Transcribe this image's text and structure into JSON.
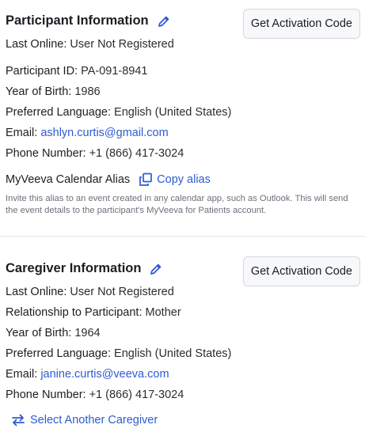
{
  "participant": {
    "title": "Participant Information",
    "activation_button": "Get Activation Code",
    "last_online_label": "Last Online:",
    "last_online_value": "User Not Registered",
    "id_label": "Participant ID:",
    "id_value": "PA-091-8941",
    "yob_label": "Year of Birth:",
    "yob_value": "1986",
    "language_label": "Preferred Language:",
    "language_value": "English (United States)",
    "email_label": "Email:",
    "email_value": "ashlyn.curtis@gmail.com",
    "phone_label": "Phone Number:",
    "phone_value": "+1 (866) 417-3024",
    "alias_label": "MyVeeva Calendar Alias",
    "copy_alias": "Copy alias",
    "alias_note": "Invite this alias to an event created in any calendar app, such as Outlook. This will send the event details to the participant's MyVeeva for Patients account."
  },
  "caregiver": {
    "title": "Caregiver Information",
    "activation_button": "Get Activation Code",
    "last_online_label": "Last Online:",
    "last_online_value": "User Not Registered",
    "relationship_label": "Relationship to Participant:",
    "relationship_value": "Mother",
    "yob_label": "Year of Birth:",
    "yob_value": "1964",
    "language_label": "Preferred Language:",
    "language_value": "English (United States)",
    "email_label": "Email:",
    "email_value": "janine.curtis@veeva.com",
    "phone_label": "Phone Number:",
    "phone_value": "+1 (866) 417-3024",
    "select_another": "Select Another Caregiver"
  },
  "colors": {
    "link": "#2e5bd3",
    "text": "#1b1d22",
    "muted": "#6b7079"
  },
  "icons": {
    "edit": "pencil-icon",
    "copy": "copy-icon",
    "swap": "swap-arrows-icon"
  }
}
